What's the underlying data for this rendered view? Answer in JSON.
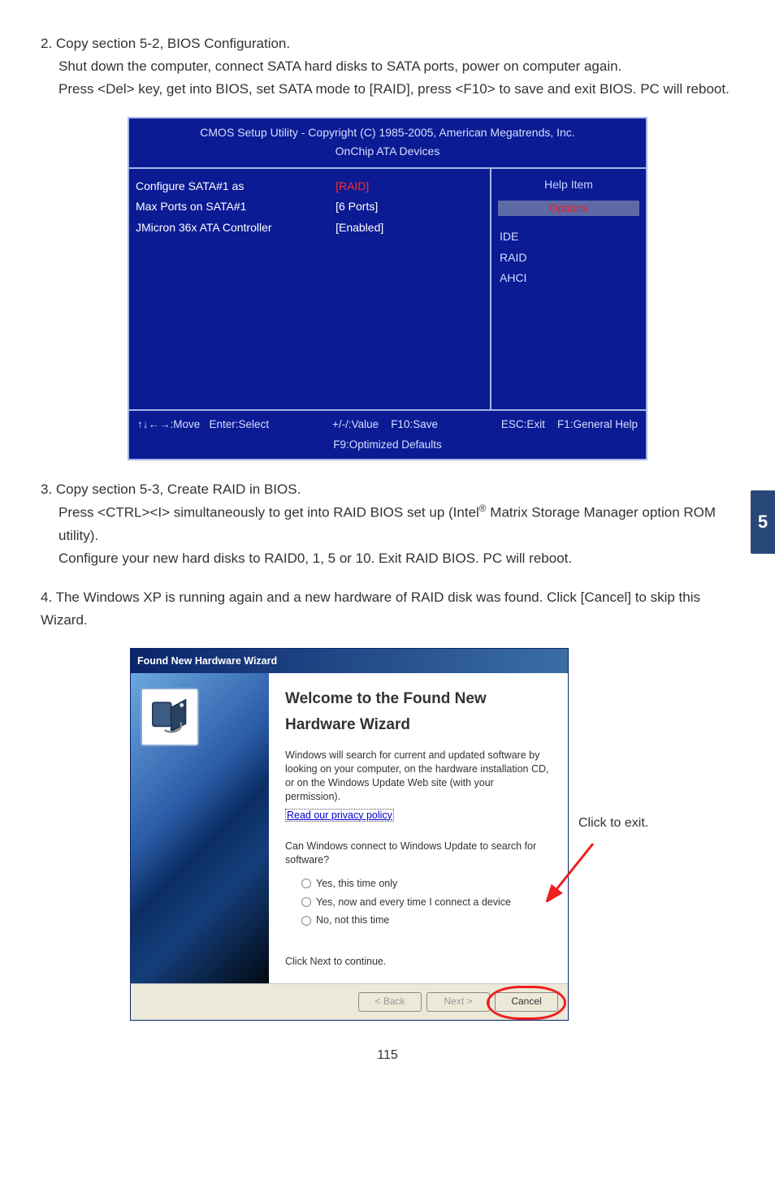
{
  "step2": {
    "line1": "2. Copy section 5-2, BIOS Configuration.",
    "line2": "Shut down the computer, connect SATA hard disks to SATA ports, power on computer again.",
    "line3": "Press <Del> key, get into BIOS, set SATA mode to [RAID], press <F10> to save and exit BIOS. PC will reboot."
  },
  "bios": {
    "title1": "CMOS Setup Utility - Copyright (C) 1985-2005, American Megatrends, Inc.",
    "title2": "OnChip ATA Devices",
    "rows": [
      {
        "label": "Configure SATA#1 as",
        "value": "[RAID]",
        "highlight": true
      },
      {
        "label": "Max Ports on SATA#1",
        "value": "[6 Ports]"
      },
      {
        "label": "JMicron 36x ATA Controller",
        "value": "[Enabled]"
      }
    ],
    "help_item": "Help Item",
    "options": "Options",
    "opts": [
      "IDE",
      "RAID",
      "AHCI"
    ],
    "footer": {
      "move": "↑↓←→:Move",
      "enter": "Enter:Select",
      "val": "+/-/:Value",
      "f10": "F10:Save",
      "esc": "ESC:Exit",
      "f1": "F1:General Help",
      "f9": "F9:Optimized Defaults"
    }
  },
  "step3": {
    "line1a": "3. Copy section 5-3, Create RAID in BIOS.",
    "line2a": "Press <CTRL><I> simultaneously to get into RAID BIOS set up (Intel",
    "line2b": " Matrix Storage Manager option ROM utility).",
    "line3": "Configure your new hard disks to RAID0, 1, 5 or 10. Exit RAID BIOS. PC will reboot."
  },
  "step4": {
    "line1": "4. The Windows XP is running again and a new hardware of RAID disk was found. Click [Cancel] to skip this Wizard."
  },
  "wizard": {
    "title": "Found New Hardware Wizard",
    "h1": "Welcome to the Found New Hardware Wizard",
    "p1": "Windows will search for current and updated software by looking on your computer, on the hardware installation CD, or on the Windows Update Web site (with your permission).",
    "privacy": "Read our privacy policy",
    "q": "Can Windows connect to Windows Update to search for software?",
    "r1": "Yes, this time only",
    "r2": "Yes, now and every time I connect a device",
    "r3": "No, not this time",
    "cont": "Click Next to continue.",
    "back": "< Back",
    "next": "Next >",
    "cancel": "Cancel"
  },
  "click_exit": "Click to exit.",
  "side_tab": "5",
  "page_num": "115",
  "reg": "®"
}
